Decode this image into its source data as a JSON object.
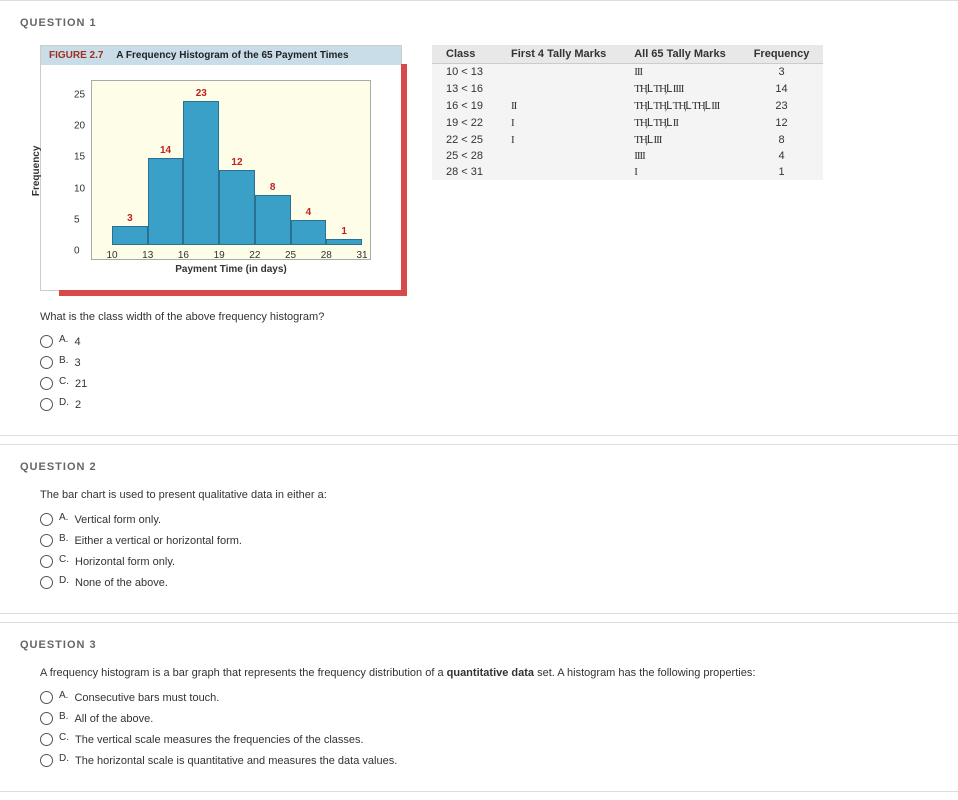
{
  "questions": [
    {
      "header": "QUESTION 1",
      "figure": {
        "label": "FIGURE 2.7",
        "title": "A Frequency Histogram of the 65 Payment Times",
        "ylabel": "Frequency",
        "xlabel": "Payment Time (in days)"
      },
      "chart_data": {
        "type": "bar",
        "categories": [
          "10",
          "13",
          "16",
          "19",
          "22",
          "25",
          "28",
          "31"
        ],
        "values": [
          3,
          14,
          23,
          12,
          8,
          4,
          1
        ],
        "ylabel": "Frequency",
        "xlabel": "Payment Time (in days)",
        "ylim": [
          0,
          25
        ],
        "yticks": [
          0,
          5,
          10,
          15,
          20,
          25
        ]
      },
      "tally": {
        "headers": [
          "Class",
          "First 4 Tally Marks",
          "All 65 Tally Marks",
          "Frequency"
        ],
        "rows": [
          {
            "class": "10 < 13",
            "first4": "",
            "all65": "III",
            "freq": "3"
          },
          {
            "class": "13 < 16",
            "first4": "",
            "all65": "ƬӉԼ ƬӉԼ IIII",
            "freq": "14"
          },
          {
            "class": "16 < 19",
            "first4": "II",
            "all65": "ƬӉԼ ƬӉԼ ƬӉԼ ƬӉԼ III",
            "freq": "23"
          },
          {
            "class": "19 < 22",
            "first4": "I",
            "all65": "ƬӉԼ ƬӉԼ II",
            "freq": "12"
          },
          {
            "class": "22 < 25",
            "first4": "I",
            "all65": "ƬӉԼ III",
            "freq": "8"
          },
          {
            "class": "25 < 28",
            "first4": "",
            "all65": "IIII",
            "freq": "4"
          },
          {
            "class": "28 < 31",
            "first4": "",
            "all65": "I",
            "freq": "1"
          }
        ]
      },
      "prompt": "What is the class width of the above frequency histogram?",
      "options": [
        {
          "letter": "A.",
          "text": "4"
        },
        {
          "letter": "B.",
          "text": "3"
        },
        {
          "letter": "C.",
          "text": "21"
        },
        {
          "letter": "D.",
          "text": "2"
        }
      ]
    },
    {
      "header": "QUESTION 2",
      "prompt": "The bar chart is used to present qualitative data in either a:",
      "options": [
        {
          "letter": "A.",
          "text": "Vertical form only."
        },
        {
          "letter": "B.",
          "text": "Either a vertical or horizontal form."
        },
        {
          "letter": "C.",
          "text": "Horizontal form only."
        },
        {
          "letter": "D.",
          "text": "None of the above."
        }
      ]
    },
    {
      "header": "QUESTION 3",
      "prompt": "A frequency histogram is a bar graph that represents the frequency distribution of a quantitative data set.  A histogram has the following properties:",
      "options": [
        {
          "letter": "A.",
          "text": "Consecutive bars must touch."
        },
        {
          "letter": "B.",
          "text": "All of the above."
        },
        {
          "letter": "C.",
          "text": "The vertical scale measures the frequencies of the classes."
        },
        {
          "letter": "D.",
          "text": "The horizontal scale is quantitative and measures the data values."
        }
      ]
    }
  ],
  "emphasis_word": "quantitative data"
}
